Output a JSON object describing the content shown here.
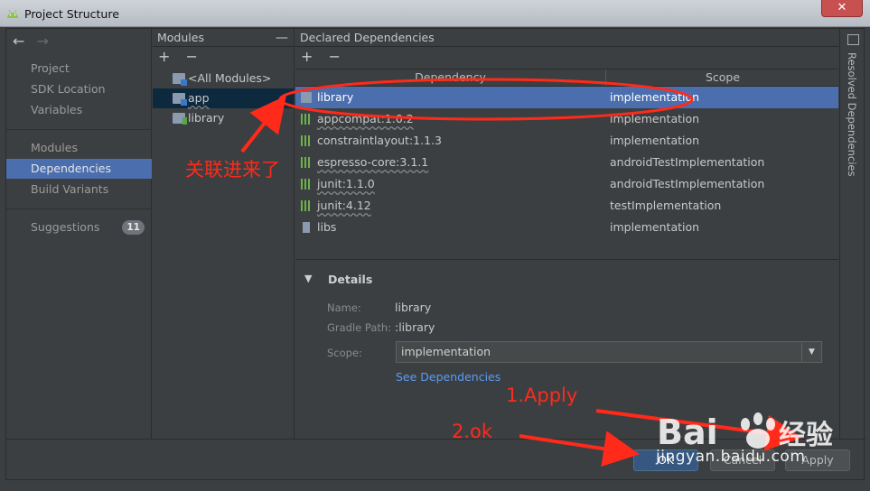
{
  "window": {
    "title": "Project Structure",
    "close_glyph": "✕"
  },
  "nav": {
    "back_glyph": "←",
    "forward_glyph": "→"
  },
  "sidebar": {
    "items": [
      {
        "label": "Project"
      },
      {
        "label": "SDK Location"
      },
      {
        "label": "Variables"
      },
      {
        "label": "Modules"
      },
      {
        "label": "Dependencies",
        "selected": true
      },
      {
        "label": "Build Variants"
      },
      {
        "label": "Suggestions",
        "badge": "11"
      }
    ]
  },
  "modules": {
    "header": "Modules",
    "collapse_glyph": "—",
    "add_glyph": "+",
    "remove_glyph": "−",
    "items": [
      {
        "label": "<All Modules>",
        "icon": "all-modules-icon"
      },
      {
        "label": "app",
        "icon": "android-module-icon",
        "selected": true
      },
      {
        "label": "library",
        "icon": "library-module-icon"
      }
    ]
  },
  "dependencies": {
    "header": "Declared Dependencies",
    "add_glyph": "+",
    "remove_glyph": "−",
    "columns": {
      "dependency": "Dependency",
      "scope": "Scope"
    },
    "rows": [
      {
        "name": "library",
        "scope": "implementation",
        "icon": "module-icon",
        "selected": true
      },
      {
        "name": "appcompat:1.0.2",
        "scope": "implementation",
        "icon": "library-icon"
      },
      {
        "name": "constraintlayout:1.1.3",
        "scope": "implementation",
        "icon": "library-icon"
      },
      {
        "name": "espresso-core:3.1.1",
        "scope": "androidTestImplementation",
        "icon": "library-icon"
      },
      {
        "name": "junit:1.1.0",
        "scope": "androidTestImplementation",
        "icon": "library-icon"
      },
      {
        "name": "junit:4.12",
        "scope": "testImplementation",
        "icon": "library-icon"
      },
      {
        "name": "libs",
        "scope": "implementation",
        "icon": "jar-icon"
      }
    ]
  },
  "details": {
    "title": "Details",
    "name_label": "Name:",
    "name_value": "library",
    "gradle_path_label": "Gradle Path:",
    "gradle_path_value": ":library",
    "scope_label": "Scope:",
    "scope_value": "implementation",
    "see_dependencies_link": "See Dependencies"
  },
  "resolved_panel": {
    "label": "Resolved Dependencies"
  },
  "footer": {
    "ok_label": "OK",
    "cancel_label": "Cancel",
    "apply_label": "Apply"
  },
  "annotations": {
    "linked_note": "关联进来了",
    "step_apply": "1.Apply",
    "step_ok": "2.ok",
    "color": "#ff2a1a"
  },
  "watermark": {
    "brand": "Bai du 经验",
    "url": "jingyan.baidu.com"
  },
  "colors": {
    "selection": "#4b6eaf",
    "background": "#3c3f41",
    "link": "#589df6"
  }
}
